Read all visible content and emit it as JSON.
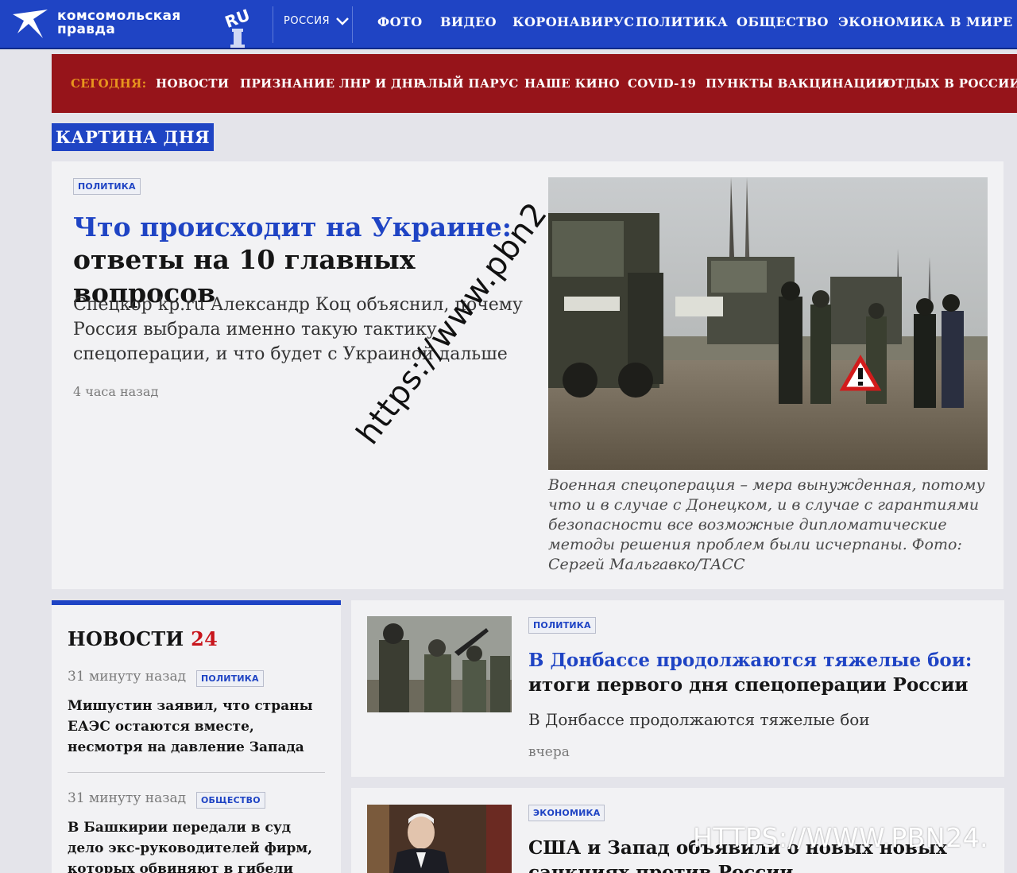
{
  "site": {
    "logo_line1": "комсомольская",
    "logo_line2": "правда",
    "logo_ru": "RU"
  },
  "topnav": {
    "region": "РОССИЯ",
    "items": [
      "ФОТО",
      "ВИДЕО",
      "КОРОНАВИРУС",
      "ПОЛИТИКА",
      "ОБЩЕСТВО",
      "ЭКОНОМИКА",
      "В МИРЕ"
    ]
  },
  "rednav": {
    "today": "СЕГОДНЯ:",
    "items": [
      "НОВОСТИ",
      "ПРИЗНАНИЕ ЛНР И ДНР",
      "АЛЫЙ ПАРУС",
      "НАШЕ КИНО",
      "COVID-19",
      "ПУНКТЫ ВАКЦИНАЦИИ",
      "ОТДЫХ В РОССИИ"
    ]
  },
  "section_label": "КАРТИНА ДНЯ",
  "main_story": {
    "tag": "ПОЛИТИКА",
    "headline_blue": "Что происходит на Украине:",
    "headline_black": "ответы на 10 главных вопросов",
    "lead": "Спецкор kp.ru Александр Коц объяснил, почему Россия выбрала именно такую тактику спецоперации, и что будет с Украиной дальше",
    "time": "4 часа назад",
    "caption": "Военная спецоперация – мера вынужденная, потому что и в случае с Донецком, и в случае с гарантиями безопасности все возможные дипломатические методы решения проблем были исчерпаны. Фото: Сергей Мальгавко/ТАСС"
  },
  "news24": {
    "title": "НОВОСТИ",
    "title_num": "24",
    "items": [
      {
        "time": "31 минуту назад",
        "tag": "ПОЛИТИКА",
        "headline": "Мишустин заявил, что страны ЕАЭС остаются вместе, несмотря на давление Запада"
      },
      {
        "time": "31 минуту назад",
        "tag": "ОБЩЕСТВО",
        "headline": "В Башкирии передали в суд дело экс-руководителей фирм, которых обвиняют в гибели"
      }
    ]
  },
  "story2": {
    "tag": "ПОЛИТИКА",
    "headline_blue": "В Донбассе продолжаются тяжелые бои:",
    "headline_black": "итоги первого дня спецоперации России",
    "lead": "В Донбассе продолжаются тяжелые бои",
    "time": "вчера"
  },
  "story3": {
    "tag": "ЭКОНОМИКА",
    "headline": "США и Запад объявили о новых новых санкциях против России"
  },
  "watermarks": {
    "diagonal": "https://www.pbn2",
    "corner": "HTTPS://WWW.PBN24."
  },
  "colors": {
    "brand_blue": "#1f44c4",
    "brand_red": "#96141a",
    "accent_orange": "#e8951e"
  }
}
